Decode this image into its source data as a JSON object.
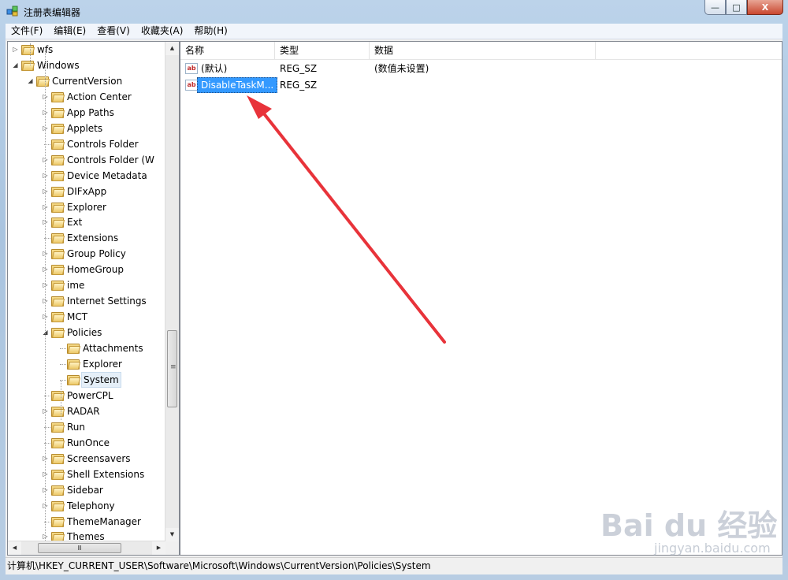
{
  "window": {
    "title": "注册表编辑器",
    "caption_buttons": [
      "minimize-icon",
      "maximize-icon",
      "close-icon"
    ]
  },
  "menu": [
    "文件(F)",
    "编辑(E)",
    "查看(V)",
    "收藏夹(A)",
    "帮助(H)"
  ],
  "tree": [
    {
      "label": "wfs",
      "level": 0,
      "expander": "collapsed"
    },
    {
      "label": "Windows",
      "level": 0,
      "expander": "expanded"
    },
    {
      "label": "CurrentVersion",
      "level": 1,
      "expander": "expanded"
    },
    {
      "label": "Action Center",
      "level": 2,
      "expander": "collapsed"
    },
    {
      "label": "App Paths",
      "level": 2,
      "expander": "collapsed"
    },
    {
      "label": "Applets",
      "level": 2,
      "expander": "collapsed"
    },
    {
      "label": "Controls Folder",
      "level": 2,
      "expander": "none"
    },
    {
      "label": "Controls Folder (W",
      "level": 2,
      "expander": "collapsed"
    },
    {
      "label": "Device Metadata",
      "level": 2,
      "expander": "collapsed"
    },
    {
      "label": "DIFxApp",
      "level": 2,
      "expander": "collapsed"
    },
    {
      "label": "Explorer",
      "level": 2,
      "expander": "collapsed"
    },
    {
      "label": "Ext",
      "level": 2,
      "expander": "collapsed"
    },
    {
      "label": "Extensions",
      "level": 2,
      "expander": "none"
    },
    {
      "label": "Group Policy",
      "level": 2,
      "expander": "collapsed"
    },
    {
      "label": "HomeGroup",
      "level": 2,
      "expander": "collapsed"
    },
    {
      "label": "ime",
      "level": 2,
      "expander": "collapsed"
    },
    {
      "label": "Internet Settings",
      "level": 2,
      "expander": "collapsed"
    },
    {
      "label": "MCT",
      "level": 2,
      "expander": "collapsed"
    },
    {
      "label": "Policies",
      "level": 2,
      "expander": "expanded"
    },
    {
      "label": "Attachments",
      "level": 3,
      "expander": "none"
    },
    {
      "label": "Explorer",
      "level": 3,
      "expander": "none"
    },
    {
      "label": "System",
      "level": 3,
      "expander": "none",
      "selected": true
    },
    {
      "label": "PowerCPL",
      "level": 2,
      "expander": "none"
    },
    {
      "label": "RADAR",
      "level": 2,
      "expander": "collapsed"
    },
    {
      "label": "Run",
      "level": 2,
      "expander": "none"
    },
    {
      "label": "RunOnce",
      "level": 2,
      "expander": "none"
    },
    {
      "label": "Screensavers",
      "level": 2,
      "expander": "collapsed"
    },
    {
      "label": "Shell Extensions",
      "level": 2,
      "expander": "collapsed"
    },
    {
      "label": "Sidebar",
      "level": 2,
      "expander": "collapsed"
    },
    {
      "label": "Telephony",
      "level": 2,
      "expander": "collapsed"
    },
    {
      "label": "ThemeManager",
      "level": 2,
      "expander": "none"
    },
    {
      "label": "Themes",
      "level": 2,
      "expander": "collapsed"
    }
  ],
  "list": {
    "columns": [
      "名称",
      "类型",
      "数据"
    ],
    "rows": [
      {
        "name": "(默认)",
        "type": "REG_SZ",
        "data": "(数值未设置)",
        "icon": "string-value-icon"
      },
      {
        "name": "DisableTaskM...",
        "type": "REG_SZ",
        "data": "",
        "icon": "string-value-icon",
        "selected": true
      }
    ]
  },
  "status": {
    "path": "计算机\\HKEY_CURRENT_USER\\Software\\Microsoft\\Windows\\CurrentVersion\\Policies\\System"
  },
  "watermark": {
    "logo": "Bai du 经验",
    "site": "jingyan.baidu.com"
  },
  "colors": {
    "selection": "#3399ff",
    "annotation_arrow": "#e8333a"
  },
  "glyphs": {
    "icon_text": "ab",
    "grip": "≡",
    "hgrip": "Ⅲ",
    "scroll_up": "▲",
    "scroll_down": "▼",
    "scroll_left": "◀",
    "scroll_right": "▶",
    "expanded": "◢",
    "collapsed": "▷",
    "minimize": "—",
    "maximize": "□",
    "close": "X"
  }
}
